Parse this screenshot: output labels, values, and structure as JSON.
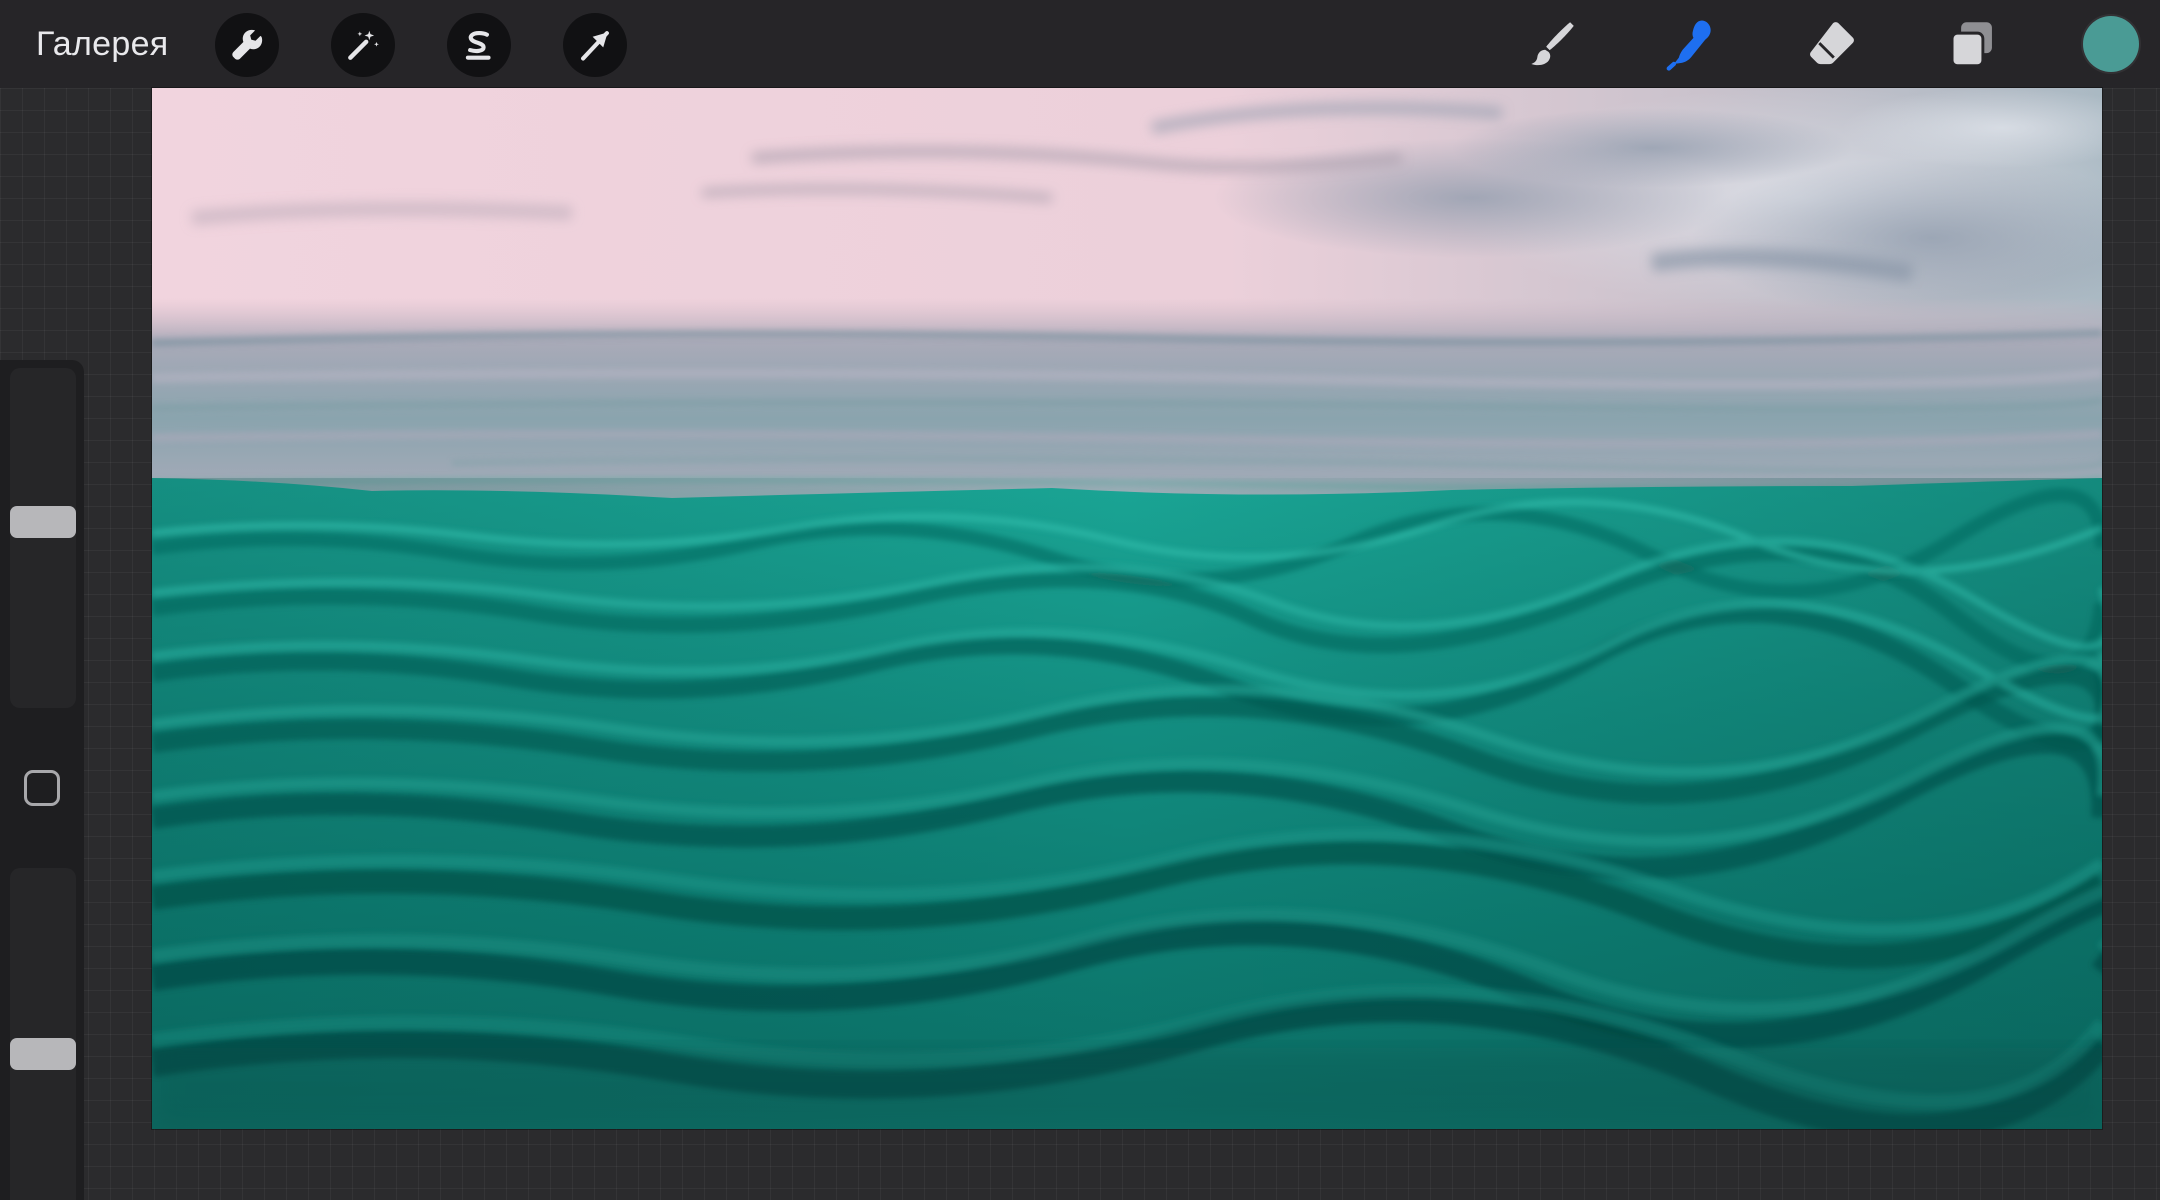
{
  "toolbar": {
    "gallery_label": "Галерея",
    "left_tools": [
      {
        "name": "actions",
        "icon": "wrench-icon"
      },
      {
        "name": "adjustments",
        "icon": "magic-wand-icon"
      },
      {
        "name": "selection",
        "icon": "selection-s-icon"
      },
      {
        "name": "transform",
        "icon": "arrow-cursor-icon"
      }
    ],
    "right_tools": [
      {
        "name": "brush",
        "icon": "brush-icon",
        "active": false
      },
      {
        "name": "smudge",
        "icon": "smudge-finger-icon",
        "active": true
      },
      {
        "name": "eraser",
        "icon": "eraser-icon",
        "active": false
      },
      {
        "name": "layers",
        "icon": "layers-icon",
        "active": false
      }
    ],
    "current_color": "#4a9b95",
    "active_tool_color": "#1e6ff0"
  },
  "sidebar": {
    "brush_size_level": 0.6,
    "opacity_level": 0.38
  },
  "canvas": {
    "artwork": "seascape",
    "sky_colors": [
      "#f0d3dc",
      "#c9bcc7",
      "#9fb4c0"
    ],
    "sea_colors": [
      "#179a8c",
      "#0f7d72",
      "#075a52"
    ]
  }
}
